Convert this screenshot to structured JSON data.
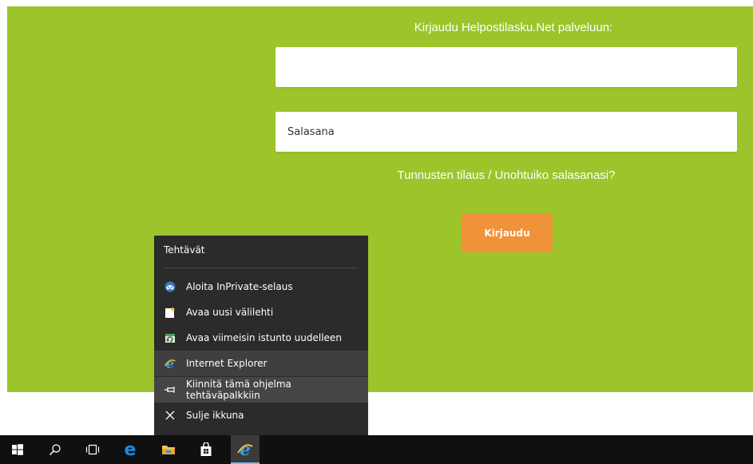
{
  "login": {
    "title": "Kirjaudu Helpostilasku.Net palveluun:",
    "username_value": "",
    "password_placeholder": "Salasana",
    "link_register": "Tunnusten tilaus",
    "link_separator": " / ",
    "link_forgot": "Unohtuiko salasanasi?",
    "login_button": "Kirjaudu",
    "colors": {
      "background": "#9dc42b",
      "button": "#f0923a"
    }
  },
  "jumplist": {
    "header": "Tehtävät",
    "items": [
      {
        "label": "Aloita InPrivate-selaus",
        "icon": "inprivate-icon"
      },
      {
        "label": "Avaa uusi välilehti",
        "icon": "new-tab-icon"
      },
      {
        "label": "Avaa viimeisin istunto uudelleen",
        "icon": "reopen-session-icon"
      },
      {
        "label": "Internet Explorer",
        "icon": "internet-explorer-icon"
      },
      {
        "label": "Kiinnitä tämä ohjelma tehtäväpalkkiin",
        "icon": "pin-icon"
      },
      {
        "label": "Sulje ikkuna",
        "icon": "close-icon"
      }
    ]
  },
  "taskbar": {
    "icons": [
      "windows-start-icon",
      "search-icon",
      "task-view-icon",
      "edge-icon",
      "file-explorer-icon",
      "store-icon",
      "internet-explorer-icon"
    ],
    "active": "internet-explorer-icon"
  }
}
